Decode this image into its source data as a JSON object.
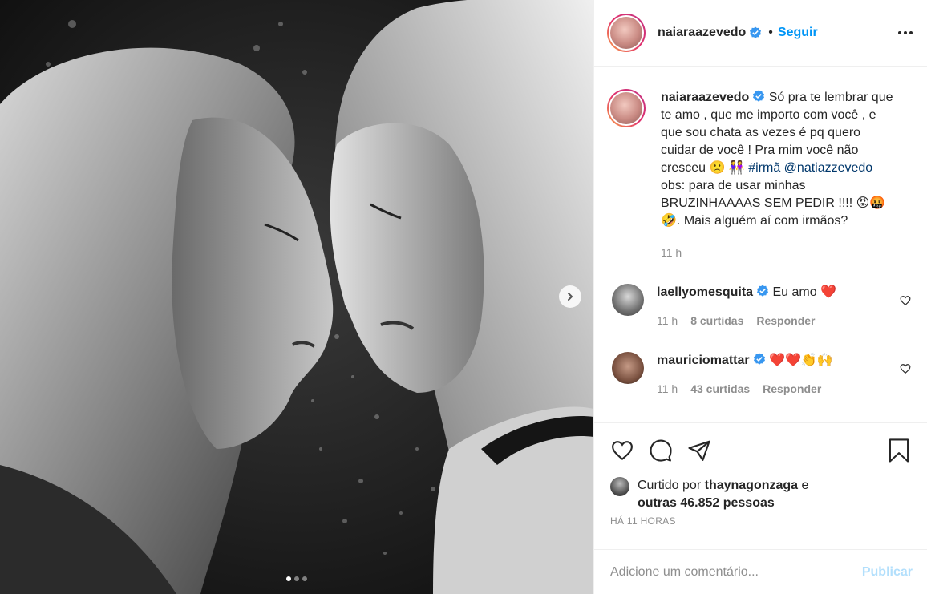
{
  "post": {
    "username": "naiaraazevedo",
    "follow_label": "Seguir",
    "bullet": "•",
    "caption_parts": {
      "text1": "Só pra te lembrar que te amo , que me importo com você , e que sou chata as vezes é pq quero cuidar de você ! Pra mim você não cresceu 🙁 👭 ",
      "hashtag": "#irmã",
      "mention": "@natiazzevedo",
      "text2": " obs: para de usar minhas BRUZINHAAAAS SEM PEDIR !!!! 😡🤬🤣. Mais alguém aí com irmãos?"
    },
    "caption_time": "11 h",
    "carousel": {
      "count": 3,
      "active_index": 0
    }
  },
  "comments": [
    {
      "username": "laellyomesquita",
      "text": "Eu amo ❤️",
      "time": "11 h",
      "likes": "8 curtidas",
      "reply": "Responder"
    },
    {
      "username": "mauriciomattar",
      "text": "❤️❤️👏🙌",
      "time": "11 h",
      "likes": "43 curtidas",
      "reply": "Responder"
    }
  ],
  "likes": {
    "prefix": "Curtido por",
    "liker": "thaynagonzaga",
    "conj": "e",
    "others": "outras 46.852 pessoas"
  },
  "ago": "HÁ 11 HORAS",
  "add_comment": {
    "placeholder": "Adicione um comentário...",
    "publish_label": "Publicar"
  },
  "colors": {
    "link": "#0095f6",
    "publish_disabled": "#b2dffc",
    "muted": "#8e8e8e",
    "heart": "#ed4956"
  }
}
